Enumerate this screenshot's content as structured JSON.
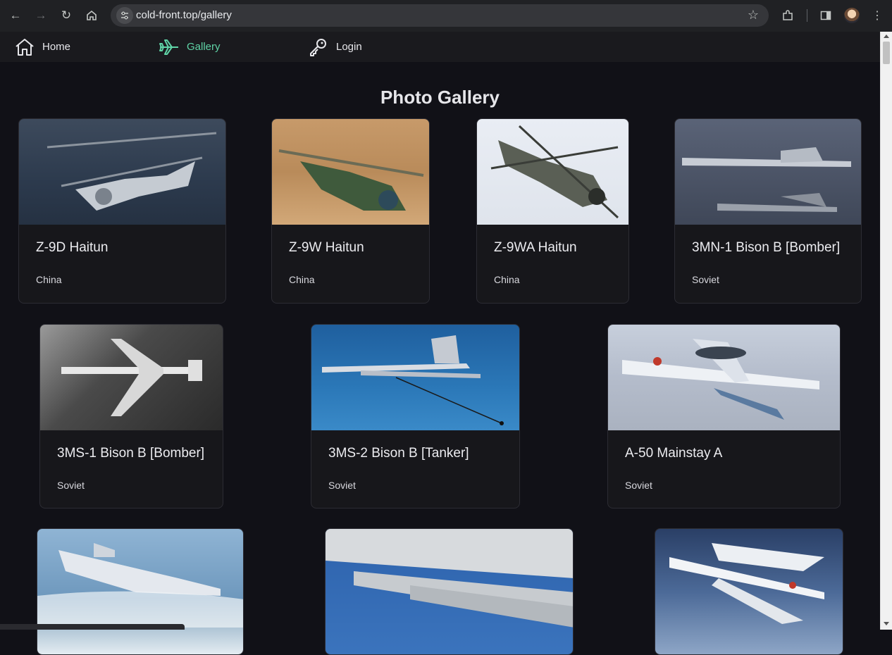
{
  "browser": {
    "url": "cold-front.top/gallery",
    "accent": "#5fd3a6"
  },
  "site_nav": {
    "items": [
      {
        "label": "Home",
        "icon": "home-icon",
        "active": false
      },
      {
        "label": "Gallery",
        "icon": "airplane-icon",
        "active": true
      },
      {
        "label": "Login",
        "icon": "key-icon",
        "active": false
      }
    ]
  },
  "gallery": {
    "title": "Photo Gallery",
    "cards": [
      {
        "name": "Z-9D Haitun",
        "origin": "China"
      },
      {
        "name": "Z-9W Haitun",
        "origin": "China"
      },
      {
        "name": "Z-9WA Haitun",
        "origin": "China"
      },
      {
        "name": "3MN-1 Bison B [Bomber]",
        "origin": "Soviet"
      },
      {
        "name": "3MS-1 Bison B [Bomber]",
        "origin": "Soviet"
      },
      {
        "name": "3MS-2 Bison B [Tanker]",
        "origin": "Soviet"
      },
      {
        "name": "A-50 Mainstay A",
        "origin": "Soviet"
      },
      {
        "name": "",
        "origin": ""
      },
      {
        "name": "",
        "origin": ""
      },
      {
        "name": "",
        "origin": ""
      }
    ]
  }
}
